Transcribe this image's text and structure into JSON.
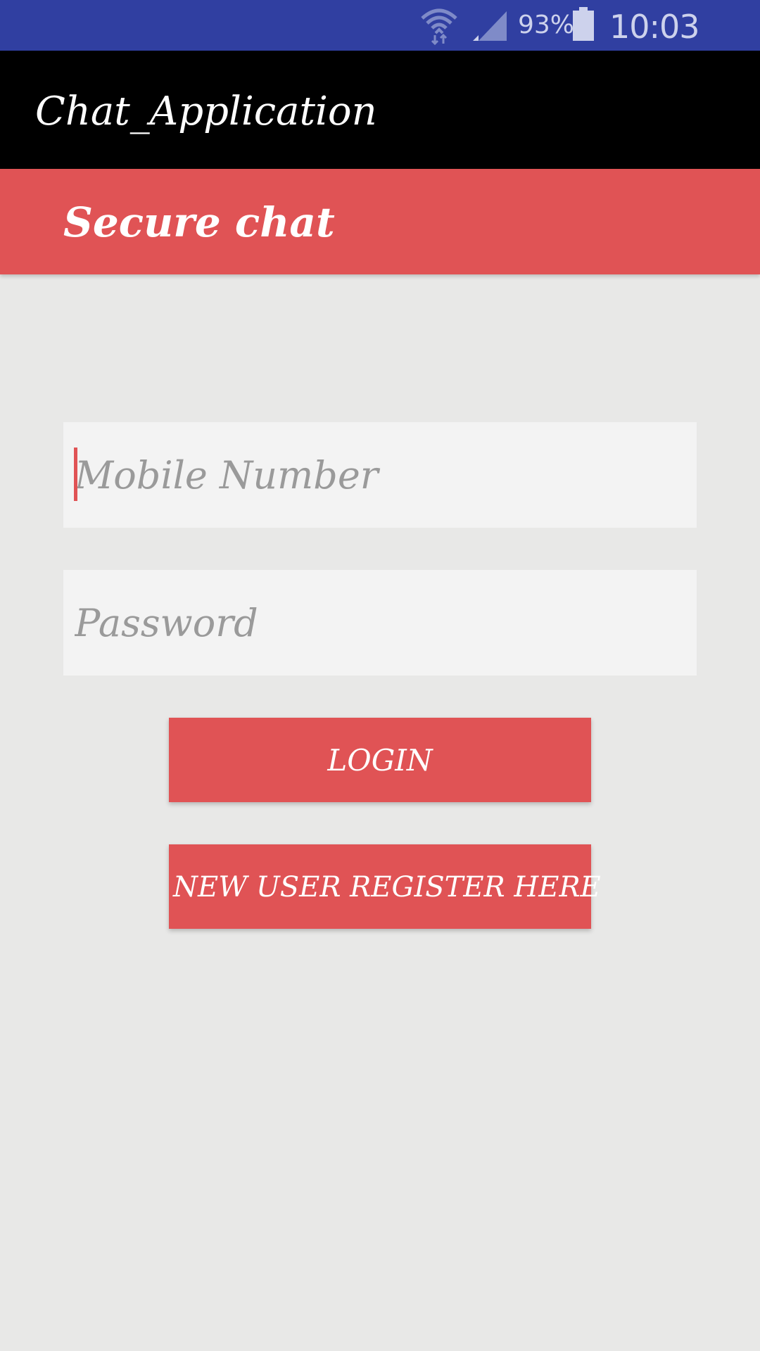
{
  "status_bar": {
    "battery_percent": "93%",
    "time": "10:03 a.m.",
    "wifi_icon": "wifi-icon",
    "signal_icon": "cell-signal-icon",
    "battery_icon": "battery-icon",
    "background_color": "#303fa1"
  },
  "app_bar": {
    "title": "Chat_Application",
    "background_color": "#000000"
  },
  "header": {
    "title": "Secure chat",
    "background_color": "#e05355"
  },
  "form": {
    "mobile_placeholder": "Mobile Number",
    "mobile_value": "",
    "password_placeholder": "Password",
    "password_value": "",
    "login_label": "LOGIN",
    "register_label": "NEW USER REGISTER HERE",
    "accent_color": "#e05355"
  }
}
